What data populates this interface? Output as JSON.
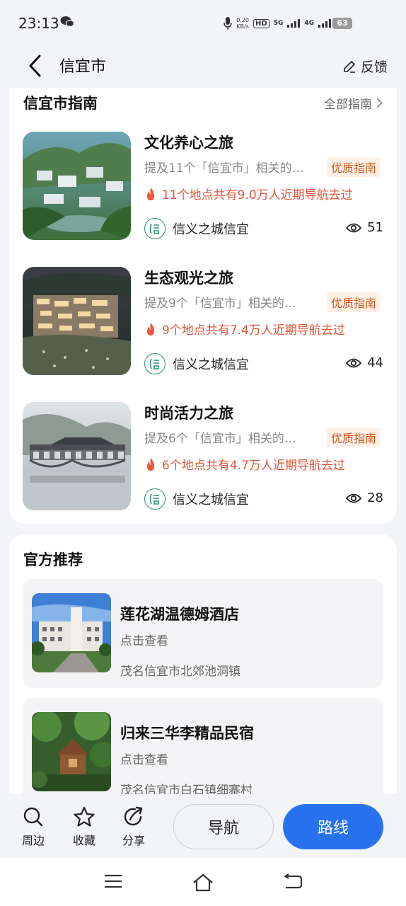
{
  "status_bar": {
    "time": "23:13",
    "speed_value": "0.20",
    "speed_unit": "KB/s",
    "hd": "HD",
    "net1": "5G",
    "net2": "4G",
    "battery": "63"
  },
  "header": {
    "title": "信宜市",
    "feedback_label": "反馈"
  },
  "guides": {
    "title": "信宜市指南",
    "all_label": "全部指南",
    "items": [
      {
        "title": "文化养心之旅",
        "desc": "提及11个「信宜市」相关的…",
        "badge": "优质指南",
        "hot": "11个地点共有9.0万人近期导航去过",
        "author": "信义之城信宜",
        "views": "51"
      },
      {
        "title": "生态观光之旅",
        "desc": "提及9个「信宜市」相关的…",
        "badge": "优质指南",
        "hot": "9个地点共有7.4万人近期导航去过",
        "author": "信义之城信宜",
        "views": "44"
      },
      {
        "title": "时尚活力之旅",
        "desc": "提及6个「信宜市」相关的…",
        "badge": "优质指南",
        "hot": "6个地点共有4.7万人近期导航去过",
        "author": "信义之城信宜",
        "views": "28"
      }
    ]
  },
  "official": {
    "title": "官方推荐",
    "items": [
      {
        "name": "莲花湖温德姆酒店",
        "action": "点击查看",
        "address": "茂名信宜市北郊池洞镇"
      },
      {
        "name": "归来三华李精品民宿",
        "action": "点击查看",
        "address": "茂名信宜市白石镇细寨村"
      }
    ]
  },
  "actions": {
    "nearby": "周边",
    "favorite": "收藏",
    "share": "分享",
    "navigate": "导航",
    "route": "路线"
  },
  "colors": {
    "accent": "#2872f0",
    "hot": "#e1553a",
    "badge_bg": "#fff1e6",
    "badge_text": "#c4561f"
  }
}
